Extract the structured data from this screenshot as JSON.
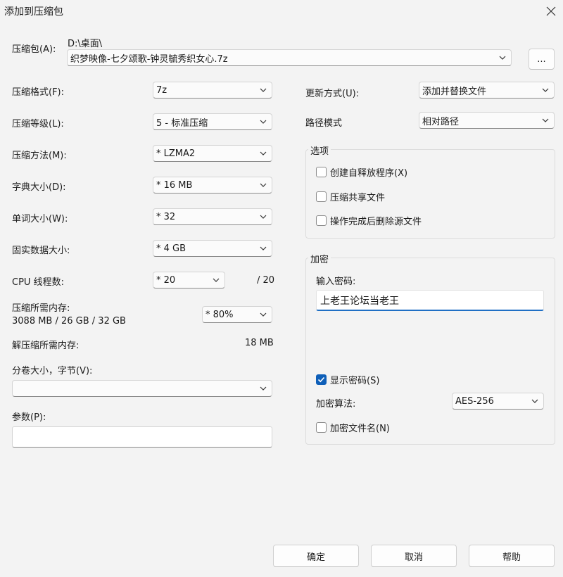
{
  "window": {
    "title": "添加到压缩包"
  },
  "archive": {
    "label": "压缩包(A):",
    "path": "D:\\桌面\\",
    "filename": "织梦映像-七夕颂歌-钟灵毓秀织女心.7z",
    "browse_label": "..."
  },
  "left": {
    "format": {
      "label": "压缩格式(F):",
      "value": "7z"
    },
    "level": {
      "label": "压缩等级(L):",
      "value": "5 - 标准压缩"
    },
    "method": {
      "label": "压缩方法(M):",
      "value": "*  LZMA2"
    },
    "dict_size": {
      "label": "字典大小(D):",
      "value": "*  16 MB"
    },
    "word_size": {
      "label": "单词大小(W):",
      "value": "*  32"
    },
    "solid_size": {
      "label": "固实数据大小:",
      "value": "*  4 GB"
    },
    "cpu_threads": {
      "label": "CPU 线程数:",
      "value": "*  20",
      "max": "/ 20"
    },
    "mem_compress": {
      "label": "压缩所需内存:",
      "detail": "3088 MB / 26 GB / 32 GB",
      "value": "* 80%"
    },
    "mem_decompress": {
      "label": "解压缩所需内存:",
      "value": "18 MB"
    },
    "split": {
      "label": "分卷大小，字节(V):",
      "value": ""
    },
    "params": {
      "label": "参数(P):",
      "value": ""
    }
  },
  "right": {
    "update_mode": {
      "label": "更新方式(U):",
      "value": "添加并替换文件"
    },
    "path_mode": {
      "label": "路径模式",
      "value": "相对路径"
    },
    "options": {
      "title": "选项",
      "sfx": {
        "label": "创建自释放程序(X)",
        "checked": false
      },
      "shared": {
        "label": "压缩共享文件",
        "checked": false
      },
      "delete_after": {
        "label": "操作完成后删除源文件",
        "checked": false
      }
    },
    "encryption": {
      "title": "加密",
      "password_label": "输入密码:",
      "password_value": "上老王论坛当老王",
      "show_password": {
        "label": "显示密码(S)",
        "checked": true
      },
      "method_label": "加密算法:",
      "method_value": "AES-256",
      "encrypt_names": {
        "label": "加密文件名(N)",
        "checked": false
      }
    }
  },
  "buttons": {
    "ok": "确定",
    "cancel": "取消",
    "help": "帮助"
  },
  "colors": {
    "accent": "#0f5fb8",
    "background": "#f3f3f3"
  }
}
